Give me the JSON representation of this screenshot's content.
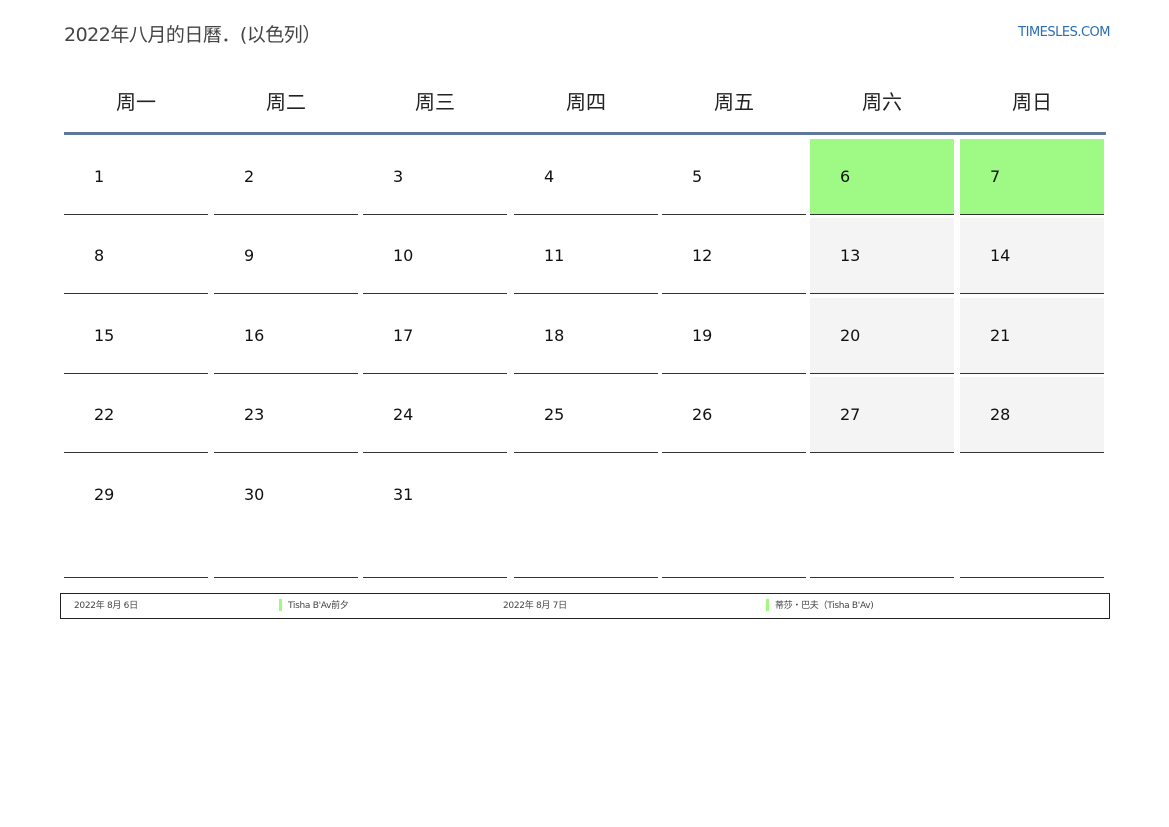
{
  "header": {
    "title": "2022年八月的日曆．(以色列）",
    "site": "TIMESLES.COM"
  },
  "calendar": {
    "weekdays": [
      "周一",
      "周二",
      "周三",
      "周四",
      "周五",
      "周六",
      "周日"
    ],
    "weeks": [
      [
        "1",
        "2",
        "3",
        "4",
        "5",
        "6",
        "7"
      ],
      [
        "8",
        "9",
        "10",
        "11",
        "12",
        "13",
        "14"
      ],
      [
        "15",
        "16",
        "17",
        "18",
        "19",
        "20",
        "21"
      ],
      [
        "22",
        "23",
        "24",
        "25",
        "26",
        "27",
        "28"
      ],
      [
        "29",
        "30",
        "31",
        "",
        "",
        "",
        ""
      ]
    ],
    "holiday_days": [
      "6",
      "7"
    ],
    "colors": {
      "holiday": "#9ef985",
      "weekend": "#f4f4f4",
      "header_rule": "#5d7899",
      "site_link": "#2a6db4"
    }
  },
  "holidays": [
    {
      "date": "2022年 8月 6日",
      "name": "Tisha B'Av前夕"
    },
    {
      "date": "2022年 8月 7日",
      "name": "蒂莎・巴夫（Tisha B'Av)"
    }
  ]
}
